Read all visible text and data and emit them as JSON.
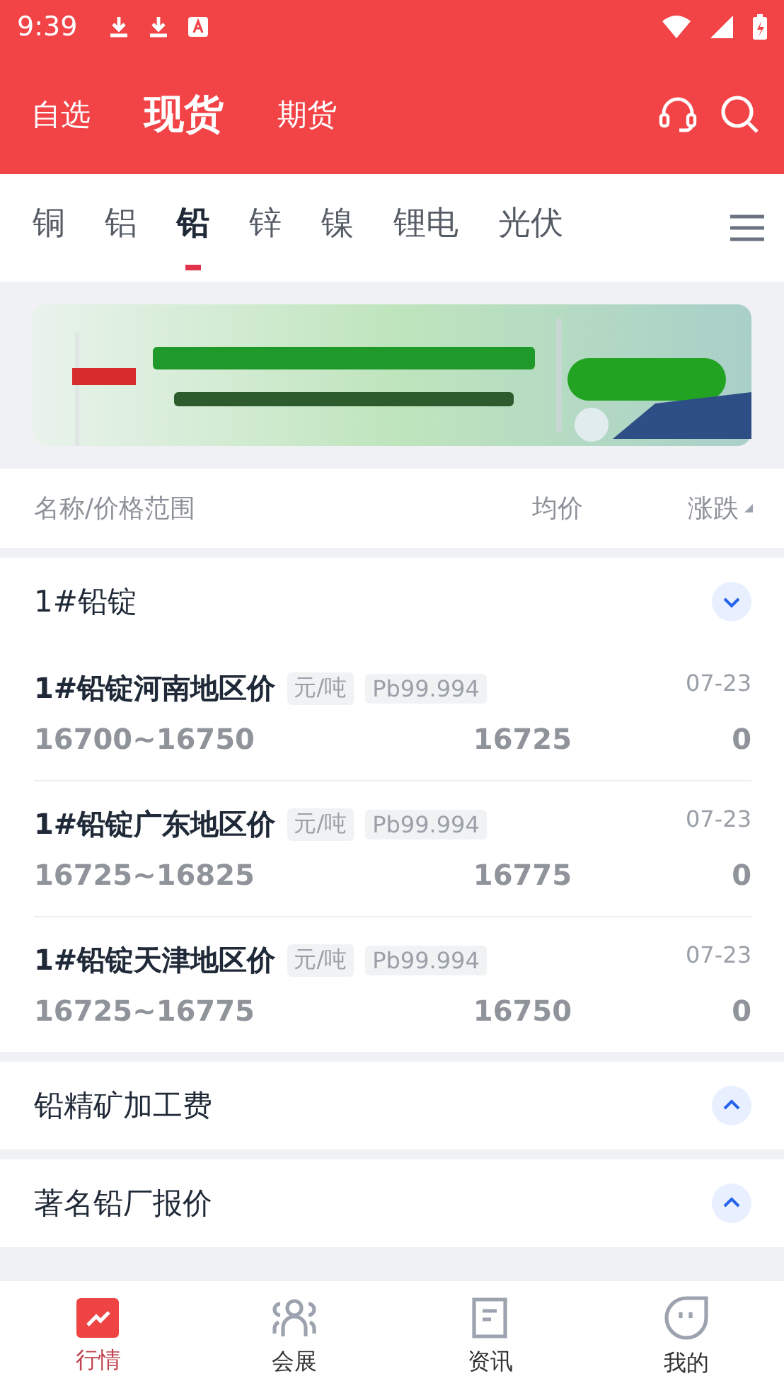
{
  "status_bar": {
    "time": "9:39"
  },
  "header_tabs": [
    {
      "label": "自选",
      "selected": false
    },
    {
      "label": "现货",
      "selected": true
    },
    {
      "label": "期货",
      "selected": false
    }
  ],
  "metal_tabs": [
    {
      "label": "铜",
      "selected": false
    },
    {
      "label": "铝",
      "selected": false
    },
    {
      "label": "铅",
      "selected": true
    },
    {
      "label": "锌",
      "selected": false
    },
    {
      "label": "镍",
      "selected": false
    },
    {
      "label": "锂电",
      "selected": false
    },
    {
      "label": "光伏",
      "selected": false
    }
  ],
  "table": {
    "columns": [
      "名称/价格范围",
      "均价",
      "涨跌"
    ]
  },
  "groups": [
    {
      "title": "1#铅锭",
      "expanded": true,
      "rows": [
        {
          "name": "1#铅锭河南地区价",
          "unit": "元/吨",
          "grade": "Pb99.994",
          "date": "07-23",
          "range": "16700~16750",
          "average": "16725",
          "change": "0"
        },
        {
          "name": "1#铅锭广东地区价",
          "unit": "元/吨",
          "grade": "Pb99.994",
          "date": "07-23",
          "range": "16725~16825",
          "average": "16775",
          "change": "0"
        },
        {
          "name": "1#铅锭天津地区价",
          "unit": "元/吨",
          "grade": "Pb99.994",
          "date": "07-23",
          "range": "16725~16775",
          "average": "16750",
          "change": "0"
        }
      ]
    },
    {
      "title": "铅精矿加工费",
      "expanded": false
    },
    {
      "title": "著名铅厂报价",
      "expanded": false
    }
  ],
  "bottom_nav": [
    {
      "label": "行情",
      "selected": true
    },
    {
      "label": "会展",
      "selected": false
    },
    {
      "label": "资讯",
      "selected": false
    },
    {
      "label": "我的",
      "selected": false
    }
  ]
}
